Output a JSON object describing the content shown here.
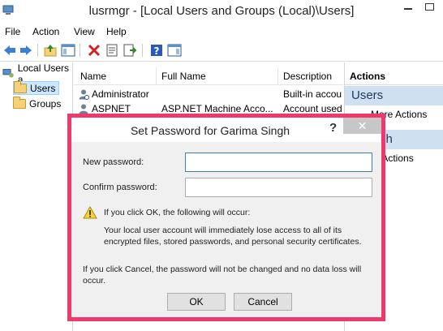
{
  "window": {
    "title": "lusrmgr - [Local Users and Groups (Local)\\Users]"
  },
  "menu": [
    "File",
    "Action",
    "View",
    "Help"
  ],
  "tree": {
    "root_label": "Local Users a",
    "items": [
      "Users",
      "Groups"
    ]
  },
  "list": {
    "columns": [
      "Name",
      "Full Name",
      "Description"
    ],
    "rows": [
      {
        "name": "Administrator",
        "full_name": "",
        "description": "Built-in accou"
      },
      {
        "name": "ASPNET",
        "full_name": "ASP.NET Machine Acco...",
        "description": "Account used"
      }
    ]
  },
  "actions": {
    "header": "Actions",
    "section1": "Users",
    "section1_item": "More Actions",
    "section2": "a Singh",
    "section2_item": "re Actions"
  },
  "dialog": {
    "title": "Set Password for Garima Singh",
    "help": "?",
    "close": "✕",
    "new_password_label": "New password:",
    "confirm_password_label": "Confirm password:",
    "new_password_value": "",
    "confirm_password_value": "",
    "warning_heading": "If you click OK, the following will occur:",
    "warning_line1": "Your local user account will immediately lose access to all of its",
    "warning_line2": "encrypted files, stored passwords, and personal security certificates.",
    "cancel_line1": "If you click Cancel, the password will not be changed and no data loss will",
    "cancel_line2": "occur.",
    "ok_label": "OK",
    "cancel_label": "Cancel"
  },
  "colors": {
    "highlight_border": "#f0386b",
    "actions_section_bg": "#cfe0f1",
    "selection_bg": "#cce8ff"
  }
}
